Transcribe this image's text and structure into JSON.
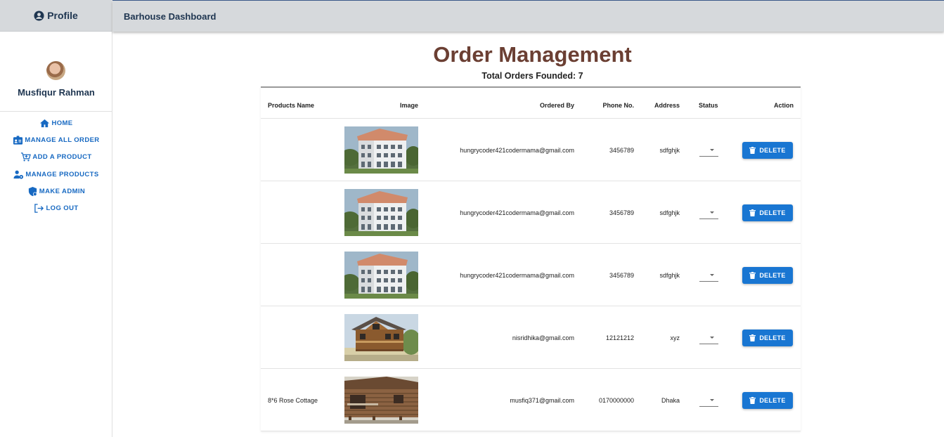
{
  "sidebar": {
    "header": "Profile",
    "user_name": "Musfiqur Rahman",
    "items": [
      {
        "label": "HOME",
        "icon": "home-icon"
      },
      {
        "label": "MANAGE ALL ORDER",
        "icon": "id-card-icon"
      },
      {
        "label": "ADD A PRODUCT",
        "icon": "cart-plus-icon"
      },
      {
        "label": "MANAGE PRODUCTS",
        "icon": "users-cog-icon"
      },
      {
        "label": "MAKE ADMIN",
        "icon": "shield-icon"
      },
      {
        "label": "LOG OUT",
        "icon": "logout-icon"
      }
    ]
  },
  "appbar": {
    "title": "Barhouse Dashboard"
  },
  "main": {
    "title": "Order Management",
    "subtitle": "Total Orders Founded: 7"
  },
  "table": {
    "headers": {
      "name": "Products Name",
      "image": "Image",
      "ordered_by": "Ordered By",
      "phone": "Phone No.",
      "address": "Address",
      "status": "Status",
      "action": "Action"
    },
    "rows": [
      {
        "name": "",
        "image": "white-apartment-building",
        "ordered_by": "hungrycoder421codermama@gmail.com",
        "phone": "3456789",
        "address": "sdfghjk",
        "status": "",
        "action": "DELETE"
      },
      {
        "name": "",
        "image": "white-apartment-building",
        "ordered_by": "hungrycoder421codermama@gmail.com",
        "phone": "3456789",
        "address": "sdfghjk",
        "status": "",
        "action": "DELETE"
      },
      {
        "name": "",
        "image": "white-apartment-building",
        "ordered_by": "hungrycoder421codermama@gmail.com",
        "phone": "3456789",
        "address": "sdfghjk",
        "status": "",
        "action": "DELETE"
      },
      {
        "name": "",
        "image": "wooden-chalet",
        "ordered_by": "nisridhika@gmail.com",
        "phone": "12121212",
        "address": "xyz",
        "status": "",
        "action": "DELETE"
      },
      {
        "name": "8*6 Rose Cottage",
        "image": "log-cabin",
        "ordered_by": "musfiq371@gmail.com",
        "phone": "0170000000",
        "address": "Dhaka",
        "status": "",
        "action": "DELETE"
      }
    ]
  },
  "colors": {
    "accent": "#1976d2",
    "title": "#6b3f33",
    "appbar": "#d6d9dc",
    "nav_text": "#1769c2"
  }
}
